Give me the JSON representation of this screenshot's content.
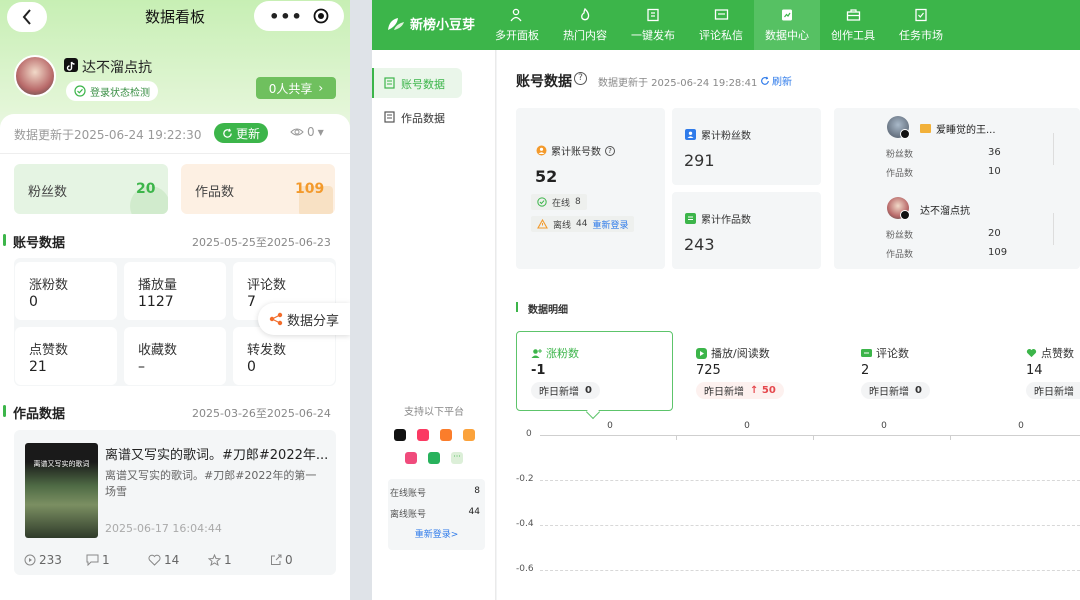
{
  "mobile": {
    "navbar": {
      "title": "数据看板"
    },
    "profile": {
      "name": "达不溜点抗",
      "login_check": "登录状态检测",
      "share_button": "0人共享"
    },
    "update_bar": {
      "text": "数据更新于2025-06-24 19:22:30",
      "refresh": "更新",
      "views": "0"
    },
    "summary": [
      {
        "label": "粉丝数",
        "value": "20"
      },
      {
        "label": "作品数",
        "value": "109"
      }
    ],
    "account_section": {
      "title": "账号数据",
      "range": "2025-05-25至2025-06-23"
    },
    "account_stats": [
      {
        "label": "涨粉数",
        "value": "0"
      },
      {
        "label": "播放量",
        "value": "1127"
      },
      {
        "label": "评论数",
        "value": "7"
      },
      {
        "label": "点赞数",
        "value": "21"
      },
      {
        "label": "收藏数",
        "value": "–"
      },
      {
        "label": "转发数",
        "value": "0"
      }
    ],
    "share_float": "数据分享",
    "works_section": {
      "title": "作品数据",
      "range": "2025-03-26至2025-06-24"
    },
    "work": {
      "thumb_caption": "离谱又写实的歌词",
      "title": "离谱又写实的歌词。#刀郎#2022年...",
      "desc": "离谱又写实的歌词。#刀郎#2022年的第一场雪",
      "date": "2025-06-17 16:04:44",
      "stats": {
        "plays": "233",
        "comments": "1",
        "likes": "14",
        "favorites": "1",
        "shares": "0"
      }
    }
  },
  "desktop": {
    "brand": "新榜小豆芽",
    "nav": [
      "多开面板",
      "热门内容",
      "一键发布",
      "评论私信",
      "数据中心",
      "创作工具",
      "任务市场"
    ],
    "sidebar": {
      "items": [
        "账号数据",
        "作品数据"
      ],
      "platforms_title": "支持以下平台",
      "online_label": "在线账号",
      "online_value": "8",
      "offline_label": "离线账号",
      "offline_value": "44",
      "relogin": "重新登录>"
    },
    "header": {
      "title": "账号数据",
      "updated": "数据更新于 2025-06-24 19:28:41",
      "refresh": "刷新"
    },
    "total_accounts": {
      "label": "累计账号数",
      "value": "52",
      "online_label": "在线",
      "online_value": "8",
      "offline_label": "离线",
      "offline_value": "44",
      "relogin": "重新登录"
    },
    "fans": {
      "label": "累计粉丝数",
      "value": "291"
    },
    "works": {
      "label": "累计作品数",
      "value": "243"
    },
    "accounts": [
      {
        "name": "爱睡觉的王...",
        "fans_label": "粉丝数",
        "fans": "36",
        "works_label": "作品数",
        "works": "10"
      },
      {
        "name": "达不溜点抗",
        "fans_label": "粉丝数",
        "fans": "20",
        "works_label": "作品数",
        "works": "109"
      }
    ],
    "detail_title": "数据明细",
    "metrics": [
      {
        "label": "涨粉数",
        "value": "-1",
        "sub_label": "昨日新增",
        "sub_value": "0"
      },
      {
        "label": "播放/阅读数",
        "value": "725",
        "sub_label": "昨日新增",
        "sub_value": "50"
      },
      {
        "label": "评论数",
        "value": "2",
        "sub_label": "昨日新增",
        "sub_value": "0"
      },
      {
        "label": "点赞数",
        "value": "14",
        "sub_label": "昨日新增",
        "sub_value": ""
      }
    ]
  },
  "chart_data": {
    "type": "line",
    "x": [
      "",
      "",
      "",
      ""
    ],
    "series": [
      {
        "values": [
          0,
          0,
          0,
          0
        ]
      }
    ],
    "yticks": [
      "0",
      "-0.2",
      "-0.4",
      "-0.6"
    ],
    "ylim": [
      -0.6,
      0
    ],
    "point_labels": [
      "0",
      "0",
      "0",
      "0"
    ]
  },
  "colors": {
    "brand_green": "#3cb54a",
    "light_green": "#eaf6ea",
    "orange": "#f39a2c",
    "red": "#e5484d"
  }
}
